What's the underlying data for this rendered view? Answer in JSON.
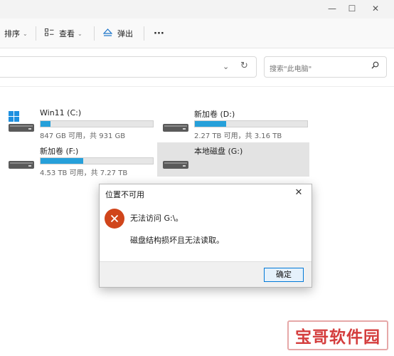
{
  "window": {
    "title_controls": [
      "—",
      "☐",
      "✕"
    ]
  },
  "toolbar": {
    "sort_label": "排序",
    "view_label": "查看",
    "eject_label": "弹出",
    "more_label": "···"
  },
  "addressbar": {
    "value": "",
    "dropdown_icon": "chevron-down-icon",
    "refresh_icon": "refresh-icon"
  },
  "search": {
    "placeholder": "搜索\"此电脑\""
  },
  "drives": [
    {
      "name": "Win11 (C:)",
      "size": "847 GB 可用，共 931 GB",
      "used_fraction": 0.09,
      "icon": "windows-drive-icon"
    },
    {
      "name": "新加卷 (D:)",
      "size": "2.27 TB 可用，共 3.16 TB",
      "used_fraction": 0.28,
      "icon": "drive-icon"
    },
    {
      "name": "新加卷 (F:)",
      "size": "4.53 TB 可用，共 7.27 TB",
      "used_fraction": 0.38,
      "icon": "drive-icon"
    },
    {
      "name": "本地磁盘 (G:)",
      "icon": "drive-icon"
    }
  ],
  "dialog": {
    "title": "位置不可用",
    "close": "✕",
    "message_line1": "无法访问 G:\\。",
    "message_line2": "磁盘结构损坏且无法读取。",
    "ok_label": "确定",
    "icon": "error-icon"
  },
  "watermark": {
    "text": "宝哥软件园"
  },
  "colors": {
    "accent": "#26a0da",
    "error": "#d0451b",
    "watermark": "#d43d3d"
  }
}
